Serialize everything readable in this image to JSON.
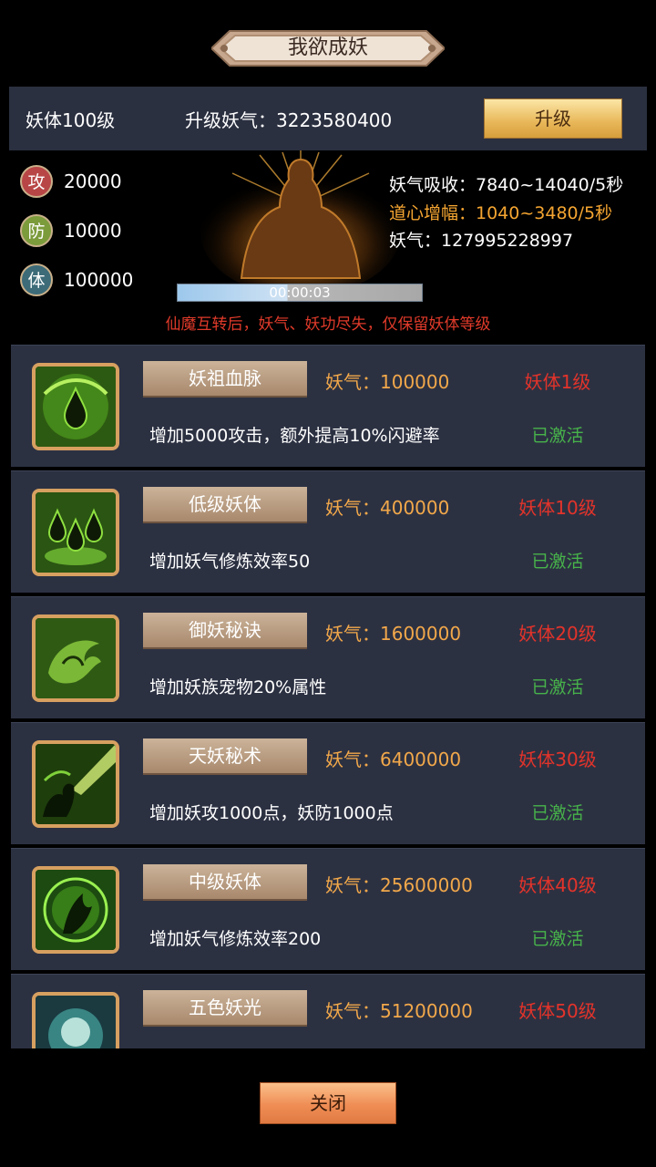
{
  "title": "我欲成妖",
  "header": {
    "level": "妖体100级",
    "upgrade_need": "升级妖气：3223580400",
    "upgrade_button": "升级"
  },
  "stats": [
    {
      "icon": "攻",
      "value": "20000",
      "color": "#b84646"
    },
    {
      "icon": "防",
      "value": "10000",
      "color": "#7c9b3b"
    },
    {
      "icon": "体",
      "value": "100000",
      "color": "#3d6b78"
    }
  ],
  "absorb": "妖气吸收：7840~14040/5秒",
  "daoxin": "道心增幅：1040~3480/5秒",
  "yaoqi_total": "妖气：127995228997",
  "progress": {
    "time": "00:00:03",
    "fraction": 0.45
  },
  "warning": "仙魔互转后，妖气、妖功尽失，仅保留妖体等级",
  "skills": [
    {
      "name": "妖祖血脉",
      "cost": "妖气：100000",
      "req": "妖体1级",
      "desc": "增加5000攻击，额外提高10%闪避率",
      "status": "已激活",
      "icon": "green-drop-icon"
    },
    {
      "name": "低级妖体",
      "cost": "妖气：400000",
      "req": "妖体10级",
      "desc": "增加妖气修炼效率50",
      "status": "已激活",
      "icon": "triple-drop-icon"
    },
    {
      "name": "御妖秘诀",
      "cost": "妖气：1600000",
      "req": "妖体20级",
      "desc": "增加妖族宠物20%属性",
      "status": "已激活",
      "icon": "beast-swirl-icon"
    },
    {
      "name": "天妖秘术",
      "cost": "妖气：6400000",
      "req": "妖体30级",
      "desc": "增加妖攻1000点，妖防1000点",
      "status": "已激活",
      "icon": "demon-claw-icon"
    },
    {
      "name": "中级妖体",
      "cost": "妖气：25600000",
      "req": "妖体40级",
      "desc": "增加妖气修炼效率200",
      "status": "已激活",
      "icon": "dragon-aura-icon"
    },
    {
      "name": "五色妖光",
      "cost": "妖气：51200000",
      "req": "妖体50级",
      "desc": "",
      "status": "",
      "icon": "five-color-light-icon"
    }
  ],
  "close_button": "关闭"
}
